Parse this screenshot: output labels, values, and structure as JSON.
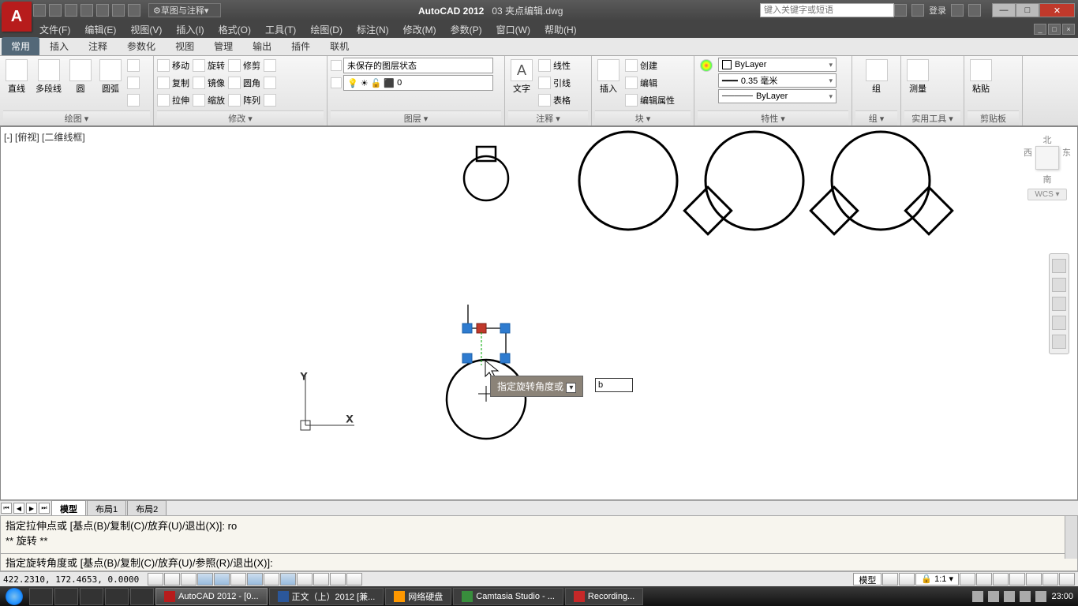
{
  "titlebar": {
    "app_letter": "A",
    "workspace": "草图与注释",
    "app_name": "AutoCAD 2012",
    "doc_name": "03 夹点编辑.dwg",
    "search_placeholder": "键入关键字或短语",
    "login": "登录",
    "min": "—",
    "max": "□",
    "close": "✕"
  },
  "menubar": [
    "文件(F)",
    "编辑(E)",
    "视图(V)",
    "插入(I)",
    "格式(O)",
    "工具(T)",
    "绘图(D)",
    "标注(N)",
    "修改(M)",
    "参数(P)",
    "窗口(W)",
    "帮助(H)"
  ],
  "ribbon_tabs": [
    "常用",
    "插入",
    "注释",
    "参数化",
    "视图",
    "管理",
    "输出",
    "插件",
    "联机"
  ],
  "ribbon": {
    "draw": {
      "title": "绘图",
      "items": [
        "直线",
        "多段线",
        "圆",
        "圆弧"
      ]
    },
    "modify": {
      "title": "修改",
      "items": [
        "移动",
        "复制",
        "拉伸",
        "旋转",
        "镜像",
        "缩放",
        "修剪",
        "圆角",
        "阵列"
      ]
    },
    "layer": {
      "title": "图层",
      "unsaved": "未保存的图层状态",
      "current": "0"
    },
    "annot": {
      "title": "注释",
      "text": "文字",
      "table": "表格",
      "linear": "线性",
      "leader": "引线"
    },
    "block": {
      "title": "块",
      "insert": "插入",
      "create": "创建",
      "edit": "编辑",
      "editattr": "编辑属性"
    },
    "props": {
      "title": "特性",
      "bylayer": "ByLayer",
      "lineweight": "0.35 毫米"
    },
    "group": {
      "title": "组",
      "label": "组"
    },
    "util": {
      "title": "实用工具",
      "measure": "测量"
    },
    "clip": {
      "title": "剪贴板",
      "paste": "粘贴"
    }
  },
  "viewport": {
    "label": "[-] [俯视] [二维线框]"
  },
  "viewcube": {
    "n": "北",
    "w": "西",
    "e": "东",
    "s": "南",
    "wcs": "WCS ▾"
  },
  "tooltip": "指定旋转角度或",
  "dyn_input": "b",
  "layout_tabs": [
    "模型",
    "布局1",
    "布局2"
  ],
  "cmd": {
    "line1": "指定拉伸点或 [基点(B)/复制(C)/放弃(U)/退出(X)]: ro",
    "line2": "** 旋转 **",
    "prompt": "指定旋转角度或 [基点(B)/复制(C)/放弃(U)/参照(R)/退出(X)]:"
  },
  "statusbar": {
    "coords": "422.2310,  172.4653,  0.0000",
    "model": "模型",
    "scale": "1:1"
  },
  "taskbar": {
    "tasks": [
      {
        "label": "AutoCAD 2012 - [0..."
      },
      {
        "label": "正文（上）2012 [兼..."
      },
      {
        "label": "网络硬盘"
      },
      {
        "label": "Camtasia Studio - ..."
      },
      {
        "label": "Recording..."
      }
    ],
    "clock": "23:00"
  }
}
